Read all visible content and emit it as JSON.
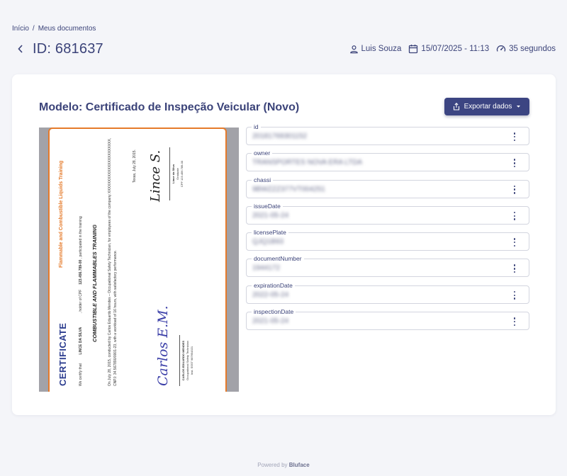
{
  "breadcrumb": {
    "home": "Início",
    "separator": "/",
    "current": "Meus documentos"
  },
  "header": {
    "title": "ID: 681637",
    "user": "Luis Souza",
    "datetime": "15/07/2025 - 11:13",
    "duration": "35 segundos"
  },
  "card": {
    "model_title": "Modelo: Certificado de Inspeção Veicular (Novo)",
    "export_label": "Exportar dados"
  },
  "certificate": {
    "title": "CERTIFICATE",
    "subtitle": "Flammable and Combustible Liquids Training",
    "certify_prefix": "We certify that",
    "holder": "LINCE DA SILVA",
    "cpf_prefix": ", holder of CPF",
    "cpf": "123.456.789-00",
    "participated": ", participated in the training",
    "training": "COMBUSTIBLE AND FLAMMABLES TRAINING",
    "body": "On July 28, 2015, conducted by Carlos Eduardo Mendes – Occupational Safety Technician, for employees of the company XXXXXXXXXXXXXXXXXXXXXXX, CNPJ: 34.567890/0001-23, with a workload of 16 hours, with satisfactory performance.",
    "place_date": "Texas, July 28, 2015.",
    "sig_left": "Carlos E.M.",
    "sig_left_name": "CARLOS EDUARDO MENDES",
    "sig_left_role": "Occupational Safety Technician",
    "sig_left_reg": "Inst. SSST 987654321",
    "sig_right": "Lince S.",
    "sig_right_name": "Lince da Silva",
    "sig_right_role": "Graduate",
    "sig_right_cpf": "CPF 123.456.789-00"
  },
  "fields": [
    {
      "label": "id",
      "value": "20181769301152"
    },
    {
      "label": "owner",
      "value": "TRANSPORTES NOVA ERA LTDA"
    },
    {
      "label": "chassi",
      "value": "9BWZZZ377VT004251"
    },
    {
      "label": "issueDate",
      "value": "2021-05-24"
    },
    {
      "label": "licensePlate",
      "value": "QJQ1B93"
    },
    {
      "label": "documentNumber",
      "value": "1944172"
    },
    {
      "label": "expirationDate",
      "value": "2022-05-24"
    },
    {
      "label": "inspectionDate",
      "value": "2021-05-24"
    }
  ],
  "footer": {
    "prefix": "Powered by",
    "brand": "Bluface"
  },
  "colors": {
    "primary": "#3c4582",
    "accent_orange": "#e57a2a",
    "background": "#f4f5f9"
  }
}
